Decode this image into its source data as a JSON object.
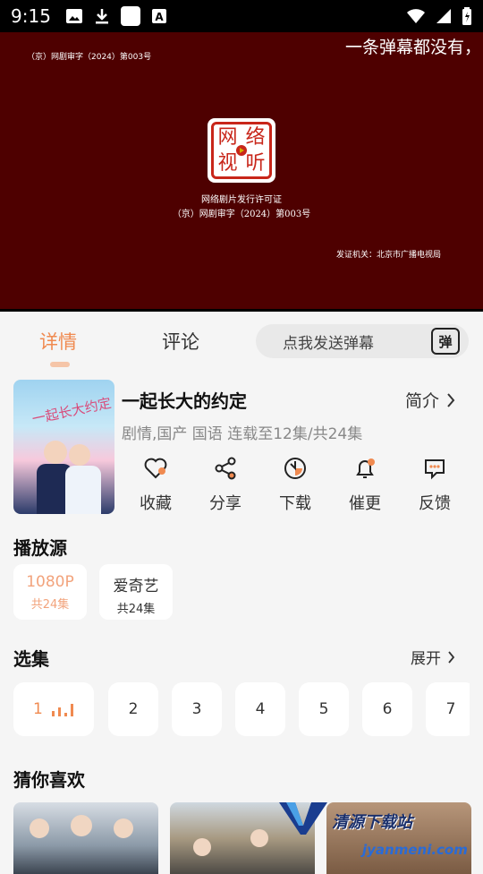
{
  "status_bar": {
    "time": "9:15",
    "icons_left": [
      "image-icon",
      "download-icon",
      "square-app-icon",
      "text-a-icon"
    ],
    "icons_right": [
      "wifi-icon",
      "signal-icon",
      "battery-icon"
    ]
  },
  "player": {
    "license_top": "（京）网剧审字（2024）第003号",
    "danmaku_text": "一条弹幕都没有，",
    "seal_chars": [
      "网",
      "络",
      "视",
      "听"
    ],
    "permit_line1": "网络剧片发行许可证",
    "permit_line2": "（京）网剧审字（2024）第003号",
    "issuer": "发证机关：北京市广播电视局"
  },
  "tabs": [
    {
      "label": "详情",
      "active": true
    },
    {
      "label": "评论",
      "active": false
    }
  ],
  "danmaku_input": {
    "placeholder": "点我发送弹幕",
    "button_label": "弹"
  },
  "show": {
    "poster_title": "一起长大约定",
    "title": "一起长大的约定",
    "intro_label": "简介",
    "meta": "剧情,国产 国语 连载至12集/共24集"
  },
  "actions": [
    {
      "label": "收藏",
      "icon": "heart-icon"
    },
    {
      "label": "分享",
      "icon": "share-icon"
    },
    {
      "label": "下载",
      "icon": "download-clock-icon"
    },
    {
      "label": "催更",
      "icon": "bell-icon"
    },
    {
      "label": "反馈",
      "icon": "feedback-icon"
    }
  ],
  "sources_title": "播放源",
  "sources": [
    {
      "name": "1080P",
      "count": "共24集",
      "active": true
    },
    {
      "name": "爱奇艺",
      "count": "共24集",
      "active": false
    }
  ],
  "episodes_title": "选集",
  "expand_label": "展开",
  "episodes": [
    "1",
    "2",
    "3",
    "4",
    "5",
    "6",
    "7"
  ],
  "recommend_title": "猜你喜欢",
  "recommend_watermark": {
    "line1": "清源下载站",
    "line2": "jyanmeni.com"
  },
  "colors": {
    "accent": "#f08a50",
    "player_bg": "#4e0000",
    "seal_red": "#c8261a"
  }
}
